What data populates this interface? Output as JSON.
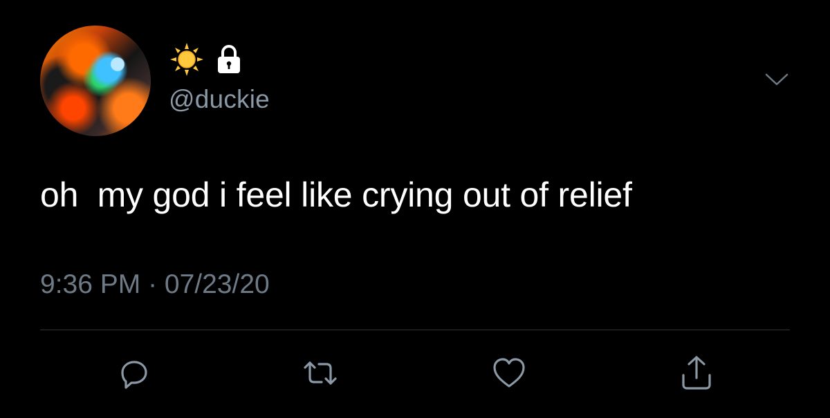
{
  "tweet": {
    "handle": "@duckie",
    "name_icons": [
      "sun-icon",
      "lock-icon"
    ],
    "text": "oh  my god i feel like crying out of relief",
    "timestamp": "9:36 PM · 07/23/20"
  },
  "actions": [
    {
      "name": "reply",
      "icon": "reply-icon"
    },
    {
      "name": "retweet",
      "icon": "retweet-icon"
    },
    {
      "name": "like",
      "icon": "heart-icon"
    },
    {
      "name": "share",
      "icon": "share-icon"
    }
  ],
  "colors": {
    "background": "#000000",
    "text": "#ffffff",
    "handle": "#8b98a5",
    "timestamp": "#6e7a86",
    "icon": "#8b98a5",
    "divider": "#2f3336",
    "sun": "#ffc83d"
  }
}
